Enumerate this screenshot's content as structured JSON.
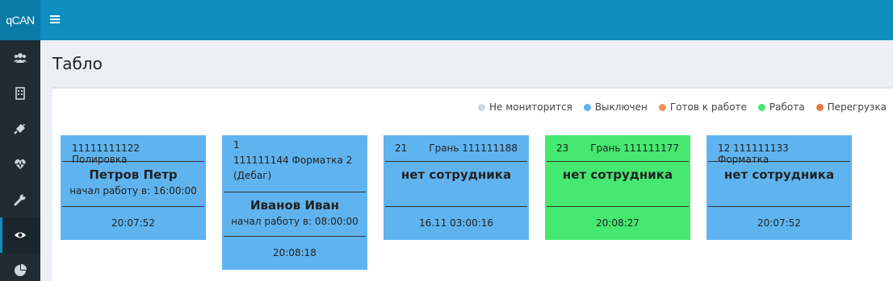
{
  "app": {
    "logo": "qCAN"
  },
  "colors": {
    "header": "#0e8fc0",
    "sidebar": "#1f2d33",
    "card_off": "#5fb4ef",
    "card_work": "#45e870"
  },
  "sidebar": {
    "items": [
      {
        "icon": "users-icon"
      },
      {
        "icon": "building-icon"
      },
      {
        "icon": "plug-icon"
      },
      {
        "icon": "heartbeat-icon"
      },
      {
        "icon": "wrench-icon"
      },
      {
        "icon": "eye-icon",
        "active": true
      },
      {
        "icon": "pie-chart-icon"
      }
    ]
  },
  "page": {
    "title": "Табло"
  },
  "legend": [
    {
      "label": "Не мониторится",
      "color": "#cfd6dc"
    },
    {
      "label": "Выключен",
      "color": "#5fb4ef"
    },
    {
      "label": "Готов к работе",
      "color": "#f0935b"
    },
    {
      "label": "Работа",
      "color": "#45e870"
    },
    {
      "label": "Перегрузка",
      "color": "#e77a3a"
    }
  ],
  "cards": [
    {
      "head_left": "11111111122 Полировка",
      "head_right": "",
      "name": "Петров Петр",
      "sub": "начал работу в: 16:00:00",
      "time": "20:07:52",
      "status": "Выключен"
    },
    {
      "head_line1": "1",
      "head_line2": "111111144 Форматка 2",
      "head_line3": "(Дебаг)",
      "name": "Иванов Иван",
      "sub": "начал работу в: 08:00:00",
      "time": "20:08:18",
      "status": "Выключен"
    },
    {
      "head_left": "21",
      "head_right": "Грань 111111188",
      "name": "нет сотрудника",
      "sub": "",
      "time": "16.11 03:00:16",
      "status": "Выключен"
    },
    {
      "head_left": "23",
      "head_right": "Грань 111111177",
      "name": "нет сотрудника",
      "sub": "",
      "time": "20:08:27",
      "status": "Работа"
    },
    {
      "head_left": "12  111111133 Форматка",
      "head_right": "",
      "name": "нет сотрудника",
      "sub": "",
      "time": "20:07:52",
      "status": "Выключен"
    }
  ]
}
